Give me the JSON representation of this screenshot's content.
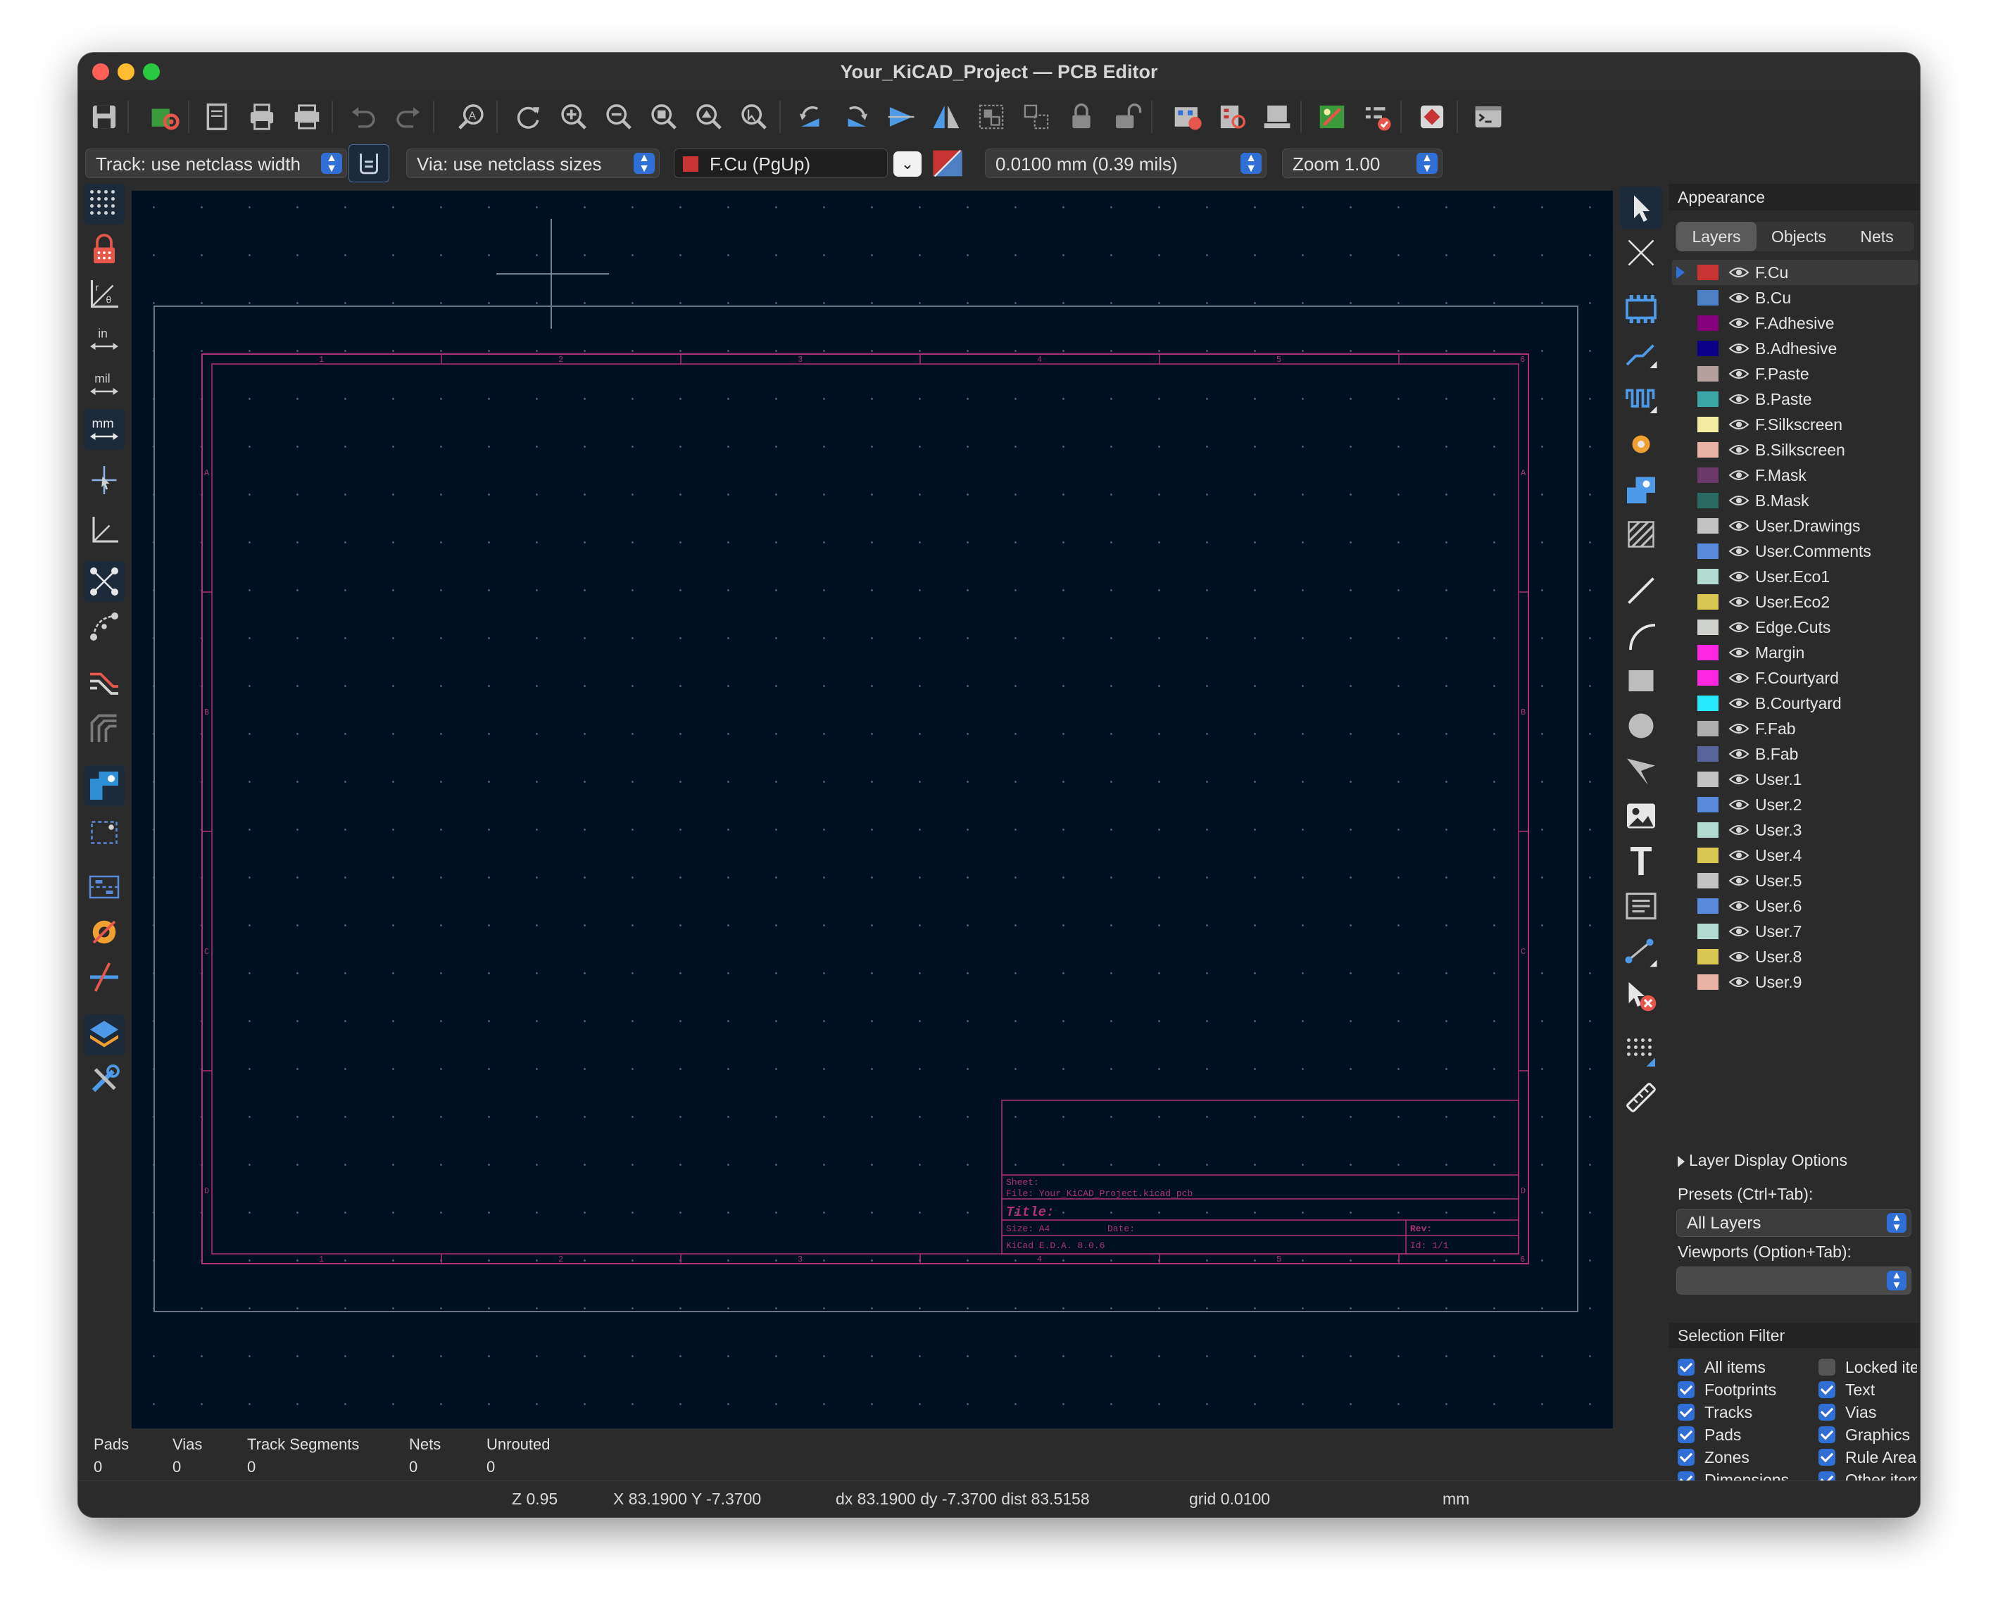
{
  "window": {
    "title": "Your_KiCAD_Project — PCB Editor"
  },
  "toolbar": {
    "icons": [
      "save-icon",
      "board-setup-icon",
      "page-settings-icon",
      "print-icon",
      "plot-icon",
      "undo-icon",
      "redo-icon",
      "find-icon",
      "redraw-icon",
      "zoom-in-icon",
      "zoom-out-icon",
      "zoom-fit-icon",
      "zoom-objects-icon",
      "zoom-selection-icon",
      "rotate-ccw-icon",
      "rotate-cw-icon",
      "flip-icon",
      "mirror-icon",
      "group-icon",
      "ungroup-icon",
      "lock-icon",
      "unlock-icon",
      "netlist-update-icon",
      "footprint-editor-icon",
      "footprint-browser-icon",
      "footprint-update-icon",
      "drc-icon",
      "scripting-plugin-icon",
      "scripting-console-icon"
    ]
  },
  "options": {
    "track_width": "Track: use netclass width",
    "via_size": "Via: use netclass sizes",
    "layer": "F.Cu (PgUp)",
    "grid": "0.0100 mm (0.39 mils)",
    "zoom": "Zoom 1.00",
    "layer_color": "#c83434"
  },
  "left_toolbar": {
    "units_in": "in",
    "units_mil": "mil",
    "units_mm": "mm",
    "icons": [
      "grid-icon",
      "lock-grid-icon",
      "polar-coords-icon",
      "inches-icon",
      "mils-icon",
      "millimeters-icon",
      "cursor-crosshair-icon",
      "axes-icon",
      "ratsnest-icon",
      "curved-ratsnest-icon",
      "net-highlight-icon",
      "track-display-icon",
      "via-display-icon",
      "zone-display-icon",
      "zone-outline-icon",
      "pad-display-icon",
      "high-contrast-icon",
      "layers-manager-icon",
      "properties-icon"
    ]
  },
  "right_toolbar": {
    "icons": [
      "select-icon",
      "local-ratsnest-icon",
      "add-footprint-icon",
      "route-track-icon",
      "tune-length-icon",
      "add-via-icon",
      "add-zone-icon",
      "add-rule-area-icon",
      "draw-line-icon",
      "draw-arc-icon",
      "draw-rectangle-icon",
      "draw-circle-icon",
      "draw-polygon-icon",
      "add-image-icon",
      "add-text-icon",
      "add-textbox-icon",
      "add-dimension-icon",
      "delete-tool-icon",
      "grid-origin-icon",
      "measure-icon"
    ]
  },
  "title_block": {
    "sheet": "Sheet:",
    "file": "File: Your_KiCAD_Project.kicad_pcb",
    "title": "Title:",
    "size": "Size: A4",
    "date": "Date:",
    "rev": "Rev:",
    "software": "KiCad E.D.A. 8.0.6",
    "id": "Id: 1/1"
  },
  "frame": {
    "top_labels": [
      "1",
      "2",
      "3",
      "4",
      "5",
      "6"
    ],
    "side_labels": [
      "A",
      "B",
      "C",
      "D"
    ]
  },
  "appearance": {
    "title": "Appearance",
    "tabs": [
      "Layers",
      "Objects",
      "Nets"
    ],
    "selected_tab": "Layers",
    "layers": [
      {
        "name": "F.Cu",
        "color": "#c83434"
      },
      {
        "name": "B.Cu",
        "color": "#4d7fc4"
      },
      {
        "name": "F.Adhesive",
        "color": "#84007c"
      },
      {
        "name": "B.Adhesive",
        "color": "#0b0087"
      },
      {
        "name": "F.Paste",
        "color": "#b4a09c"
      },
      {
        "name": "B.Paste",
        "color": "#3aa6a5"
      },
      {
        "name": "F.Silkscreen",
        "color": "#f2eda1"
      },
      {
        "name": "B.Silkscreen",
        "color": "#e8b2a7"
      },
      {
        "name": "F.Mask",
        "color": "#6b3967"
      },
      {
        "name": "B.Mask",
        "color": "#286b62"
      },
      {
        "name": "User.Drawings",
        "color": "#c2c2c2"
      },
      {
        "name": "User.Comments",
        "color": "#5989db"
      },
      {
        "name": "User.Eco1",
        "color": "#b4dbd2"
      },
      {
        "name": "User.Eco2",
        "color": "#d8c852"
      },
      {
        "name": "Edge.Cuts",
        "color": "#d0d2cd"
      },
      {
        "name": "Margin",
        "color": "#ff26e2"
      },
      {
        "name": "F.Courtyard",
        "color": "#ff26e2"
      },
      {
        "name": "B.Courtyard",
        "color": "#26e9ff"
      },
      {
        "name": "F.Fab",
        "color": "#afafaf"
      },
      {
        "name": "B.Fab",
        "color": "#58659b"
      },
      {
        "name": "User.1",
        "color": "#c2c2c2"
      },
      {
        "name": "User.2",
        "color": "#5989db"
      },
      {
        "name": "User.3",
        "color": "#b4dbd2"
      },
      {
        "name": "User.4",
        "color": "#d8c852"
      },
      {
        "name": "User.5",
        "color": "#c2c2c2"
      },
      {
        "name": "User.6",
        "color": "#5989db"
      },
      {
        "name": "User.7",
        "color": "#b4dbd2"
      },
      {
        "name": "User.8",
        "color": "#d8c852"
      },
      {
        "name": "User.9",
        "color": "#e8b2a7"
      }
    ],
    "layer_display_options": "Layer Display Options",
    "presets_label": "Presets (Ctrl+Tab):",
    "presets_value": "All Layers",
    "viewports_label": "Viewports (Option+Tab):",
    "viewports_value": ""
  },
  "selection_filter": {
    "title": "Selection Filter",
    "items": [
      {
        "label": "All items",
        "checked": true
      },
      {
        "label": "Locked items",
        "checked": false
      },
      {
        "label": "Footprints",
        "checked": true
      },
      {
        "label": "Text",
        "checked": true
      },
      {
        "label": "Tracks",
        "checked": true
      },
      {
        "label": "Vias",
        "checked": true
      },
      {
        "label": "Pads",
        "checked": true
      },
      {
        "label": "Graphics",
        "checked": true
      },
      {
        "label": "Zones",
        "checked": true
      },
      {
        "label": "Rule Areas",
        "checked": true
      },
      {
        "label": "Dimensions",
        "checked": true
      },
      {
        "label": "Other items",
        "checked": true
      }
    ]
  },
  "message_panel": {
    "items": [
      {
        "label": "Pads",
        "value": "0"
      },
      {
        "label": "Vias",
        "value": "0"
      },
      {
        "label": "Track Segments",
        "value": "0"
      },
      {
        "label": "Nets",
        "value": "0"
      },
      {
        "label": "Unrouted",
        "value": "0"
      }
    ]
  },
  "status": {
    "zoom": "Z 0.95",
    "coords": "X 83.1900  Y -7.3700",
    "delta": "dx 83.1900  dy -7.3700  dist 83.5158",
    "grid": "grid 0.0100",
    "units": "mm"
  }
}
